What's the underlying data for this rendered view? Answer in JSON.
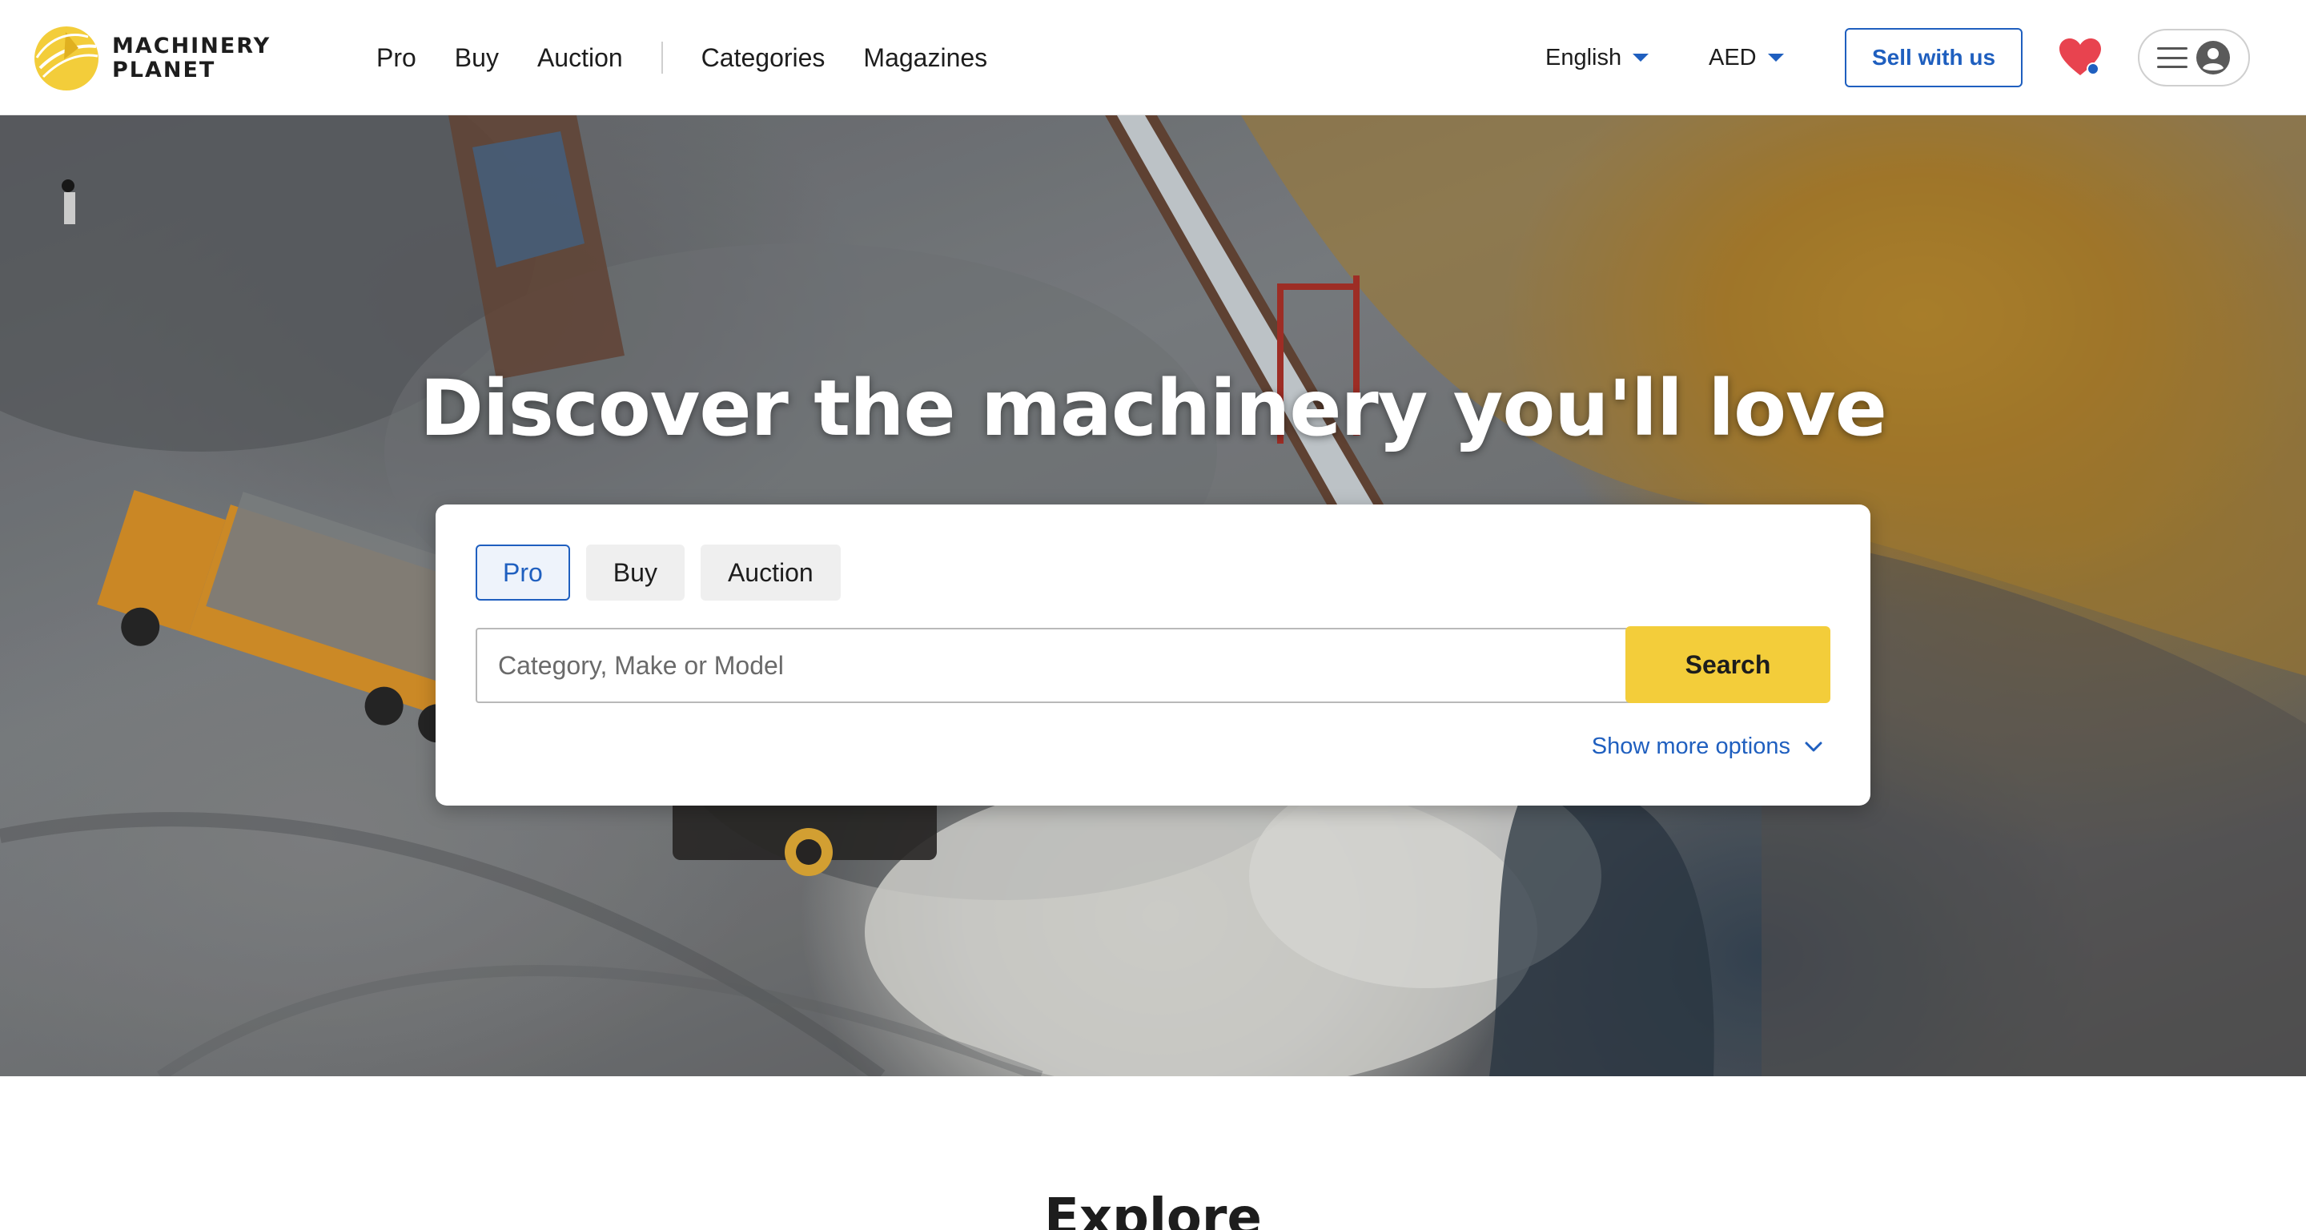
{
  "brand": {
    "name_line1": "MACHINERY",
    "name_line2": "PLANET",
    "accent_color": "#f3cd3a"
  },
  "header": {
    "nav": [
      {
        "label": "Pro"
      },
      {
        "label": "Buy"
      },
      {
        "label": "Auction"
      },
      {
        "label": "Categories"
      },
      {
        "label": "Magazines"
      }
    ],
    "language": "English",
    "currency": "AED",
    "sell_label": "Sell with us",
    "icons": [
      "heart-icon",
      "hamburger-icon",
      "user-avatar-icon",
      "chevron-down-icon"
    ],
    "link_color": "#1f5fbf"
  },
  "hero": {
    "title": "Discover the machinery you'll love"
  },
  "search": {
    "tabs": [
      {
        "label": "Pro",
        "active": true
      },
      {
        "label": "Buy",
        "active": false
      },
      {
        "label": "Auction",
        "active": false
      }
    ],
    "placeholder": "Category, Make or Model",
    "value": "",
    "button_label": "Search",
    "more_options_label": "Show more options"
  },
  "explore": {
    "title": "Explore"
  }
}
